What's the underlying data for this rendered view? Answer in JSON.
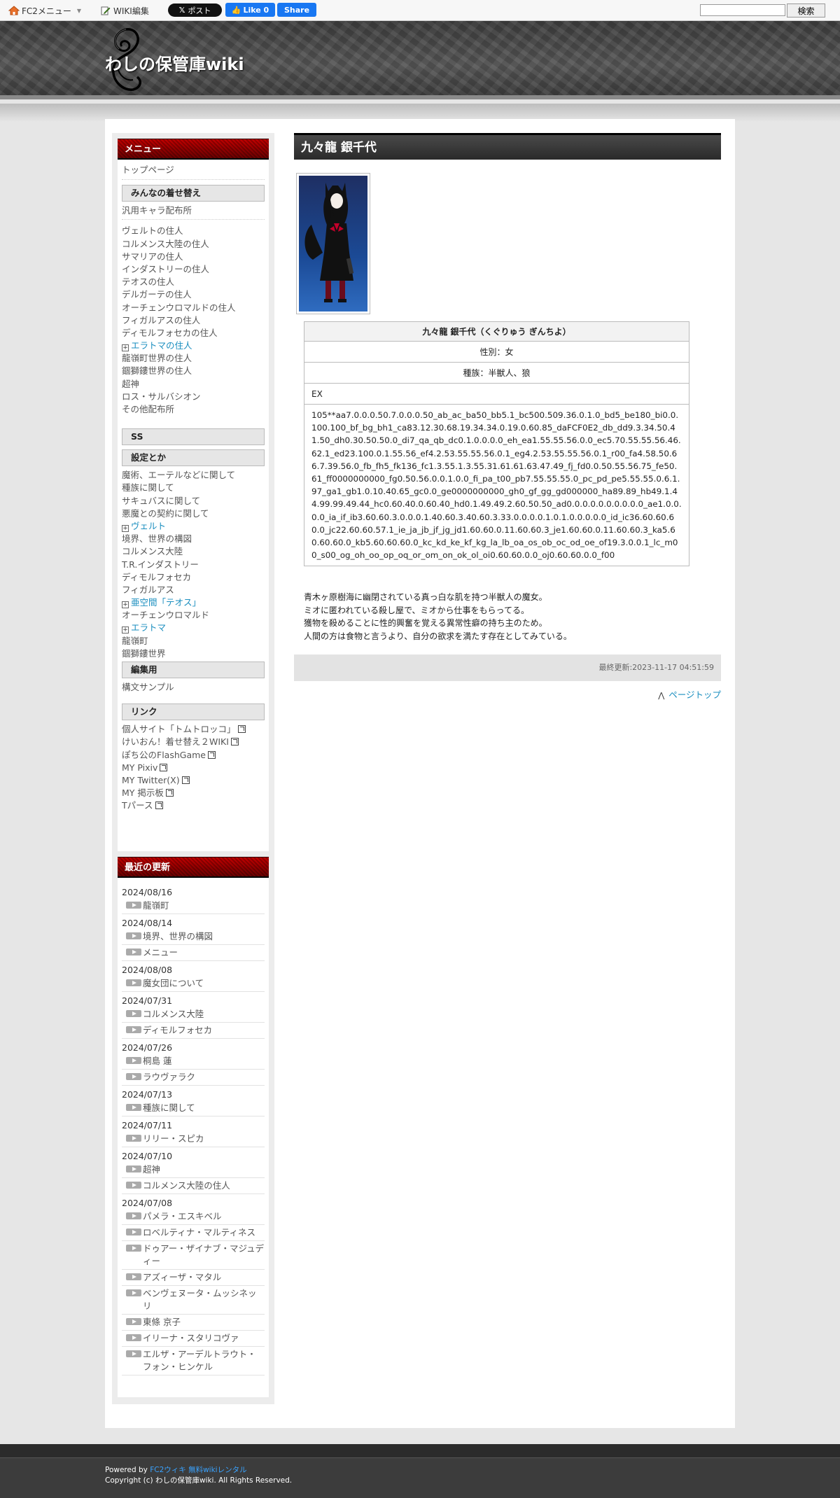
{
  "topbar": {
    "fc2_menu": "FC2メニュー",
    "wiki_edit": "WIKI編集",
    "post": "ポスト",
    "like": "Like 0",
    "share": "Share",
    "search_placeholder": "",
    "search_button": "検索"
  },
  "site": {
    "title": "わしの保管庫wiki"
  },
  "menu": {
    "heading": "メニュー",
    "top": "トップページ",
    "groups": [
      {
        "title": "みんなの着せ替え",
        "first": "汎用キャラ配布所",
        "items": [
          {
            "label": "ヴェルトの住人"
          },
          {
            "label": "コルメンス大陸の住人"
          },
          {
            "label": "サマリアの住人"
          },
          {
            "label": "インダストリーの住人"
          },
          {
            "label": "テオスの住人"
          },
          {
            "label": "デルガーテの住人"
          },
          {
            "label": "オーチェンウロマルドの住人"
          },
          {
            "label": "フィガルアスの住人"
          },
          {
            "label": "ディモルフォセカの住人"
          },
          {
            "label": "エラトマの住人",
            "expandable": true
          },
          {
            "label": "龍嶺町世界の住人"
          },
          {
            "label": "錮獅鏤世界の住人"
          },
          {
            "label": "超神"
          },
          {
            "label": "ロス・サルバシオン"
          },
          {
            "label": "その他配布所"
          }
        ]
      },
      {
        "title": "SS"
      },
      {
        "title": "設定とか",
        "items": [
          {
            "label": "魔術、エーテルなどに関して"
          },
          {
            "label": "種族に関して"
          },
          {
            "label": "サキュバスに関して"
          },
          {
            "label": "悪魔との契約に関して"
          },
          {
            "label": "ヴェルト",
            "expandable": true
          },
          {
            "label": "境界、世界の構図"
          },
          {
            "label": "コルメンス大陸"
          },
          {
            "label": "T.R.インダストリー"
          },
          {
            "label": "ディモルフォセカ"
          },
          {
            "label": "フィガルアス"
          },
          {
            "label": "亜空間「テオス」",
            "expandable": true
          },
          {
            "label": "オーチェンウロマルド"
          },
          {
            "label": "エラトマ",
            "expandable": true
          },
          {
            "label": "龍嶺町"
          },
          {
            "label": "錮獅鏤世界"
          }
        ]
      },
      {
        "title": "編集用",
        "items": [
          {
            "label": "構文サンプル"
          }
        ]
      },
      {
        "title": "リンク",
        "items": [
          {
            "label": "個人サイト「トムトロッコ」",
            "external": true
          },
          {
            "label": "けいおん！着せ替え２WIKI",
            "external": true
          },
          {
            "label": "ぽち公のFlashGame",
            "external": true
          },
          {
            "label": "MY Pixiv",
            "external": true
          },
          {
            "label": "MY Twitter(X)",
            "external": true
          },
          {
            "label": "MY 掲示板",
            "external": true
          },
          {
            "label": "Tパース",
            "external": true
          }
        ]
      }
    ]
  },
  "recent": {
    "heading": "最近の更新",
    "days": [
      {
        "date": "2024/08/16",
        "items": [
          "龍嶺町"
        ]
      },
      {
        "date": "2024/08/14",
        "items": [
          "境界、世界の構図",
          "メニュー"
        ]
      },
      {
        "date": "2024/08/08",
        "items": [
          "魔女団について"
        ]
      },
      {
        "date": "2024/07/31",
        "items": [
          "コルメンス大陸",
          "ディモルフォセカ"
        ]
      },
      {
        "date": "2024/07/26",
        "items": [
          "桐島 蓮",
          "ラウヴァラク"
        ]
      },
      {
        "date": "2024/07/13",
        "items": [
          "種族に関して"
        ]
      },
      {
        "date": "2024/07/11",
        "items": [
          "リリー・スピカ"
        ]
      },
      {
        "date": "2024/07/10",
        "items": [
          "超神",
          "コルメンス大陸の住人"
        ]
      },
      {
        "date": "2024/07/08",
        "items": [
          "パメラ・エスキベル",
          "ロベルティナ・マルティネス",
          "ドゥアー・ザイナブ・マジュディー",
          "アズィーザ・マタル",
          "ベンヴェヌータ・ムッシネッリ",
          "東條 京子",
          "イリーナ・スタリコヴァ",
          "エルザ・アーデルトラウト・フォン・ヒンケル"
        ]
      }
    ]
  },
  "page": {
    "title": "九々龍 銀千代",
    "table": {
      "name": "九々龍 銀千代（くぐりゅう ぎんちよ）",
      "gender": "性別：女",
      "race": "種族：半獣人、狼",
      "ex_label": "EX",
      "code": "105**aa7.0.0.0.50.7.0.0.0.50_ab_ac_ba50_bb5.1_bc500.509.36.0.1.0_bd5_be180_bi0.0.100.100_bf_bg_bh1_ca83.12.30.68.19.34.34.0.19.0.60.85_daFCF0E2_db_dd9.3.34.50.41.50_dh0.30.50.50.0_di7_qa_qb_dc0.1.0.0.0.0_eh_ea1.55.55.56.0.0_ec5.70.55.55.56.46.62.1_ed23.100.0.1.55.56_ef4.2.53.55.55.56.0.1_eg4.2.53.55.55.56.0.1_r00_fa4.58.50.66.7.39.56.0_fb_fh5_fk136_fc1.3.55.1.3.55.31.61.61.63.47.49_fj_fd0.0.50.55.56.75_fe50.61_ff0000000000_fg0.50.56.0.0.1.0.0_fi_pa_t00_pb7.55.55.55.0_pc_pd_pe5.55.55.0.6.1.97_ga1_gb1.0.10.40.65_gc0.0_ge0000000000_gh0_gf_gg_gd000000_ha89.89_hb49.1.44.99.99.49.44_hc0.60.40.0.60.40_hd0.1.49.49.2.60.50.50_ad0.0.0.0.0.0.0.0.0.0_ae1.0.0.0.0_ia_if_ib3.60.60.3.0.0.0.1.40.60.3.40.60.3.33.0.0.0.0.1.0.1.0.0.0.0.0_id_ic36.60.60.60.0_jc22.60.60.57.1_ie_ja_jb_jf_jg_jd1.60.60.0.11.60.60.3_je1.60.60.0.11.60.60.3_ka5.60.60.60.0_kb5.60.60.60.0_kc_kd_ke_kf_kg_la_lb_oa_os_ob_oc_od_oe_of19.3.0.0.1_lc_m00_s00_og_oh_oo_op_oq_or_om_on_ok_ol_oi0.60.60.0.0_oj0.60.60.0.0_f00"
    },
    "description": [
      "青木ヶ原樹海に幽閉されている真っ白な肌を持つ半獣人の魔女。",
      "ミオに匿われている殺し屋で、ミオから仕事をもらってる。",
      "獲物を殺めることに性的興奮を覚える異常性癖の持ち主のため。",
      "人間の方は食物と言うより、自分の欲求を満たす存在としてみている。"
    ],
    "last_modified": "最終更新:2023-11-17 04:51:59",
    "page_top": "ページトップ"
  },
  "footer": {
    "powered_by": "Powered by",
    "powered_link": "FC2ウィキ 無料wikiレンタル",
    "copyright": "Copyright (c) わしの保管庫wiki. All Rights Reserved."
  }
}
